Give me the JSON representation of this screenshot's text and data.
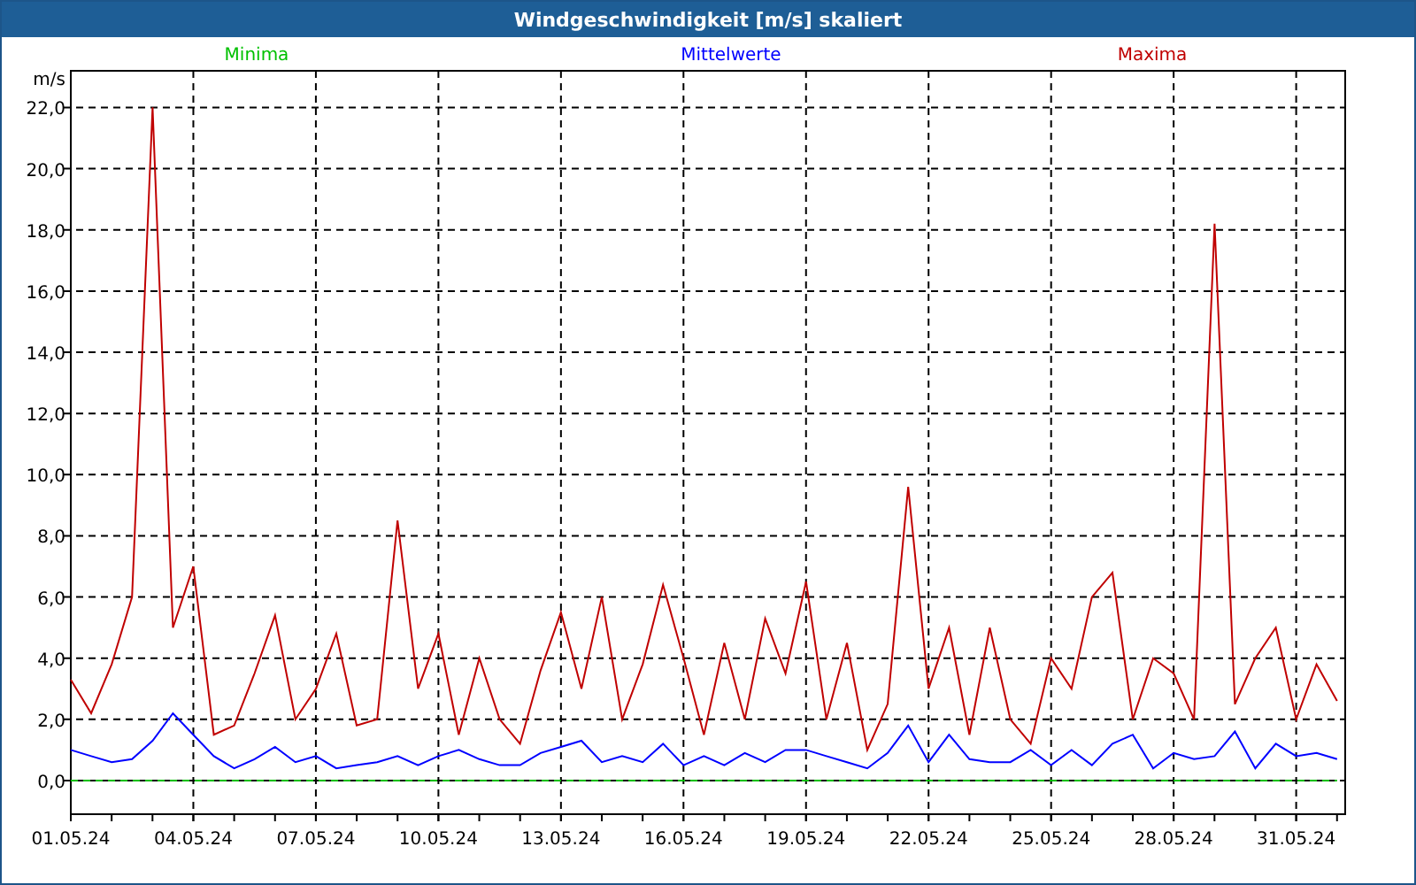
{
  "window": {
    "title": "Windgeschwindigkeit [m/s] skaliert"
  },
  "chart": {
    "chart_data": {
      "type": "line",
      "ylabel": "m/s",
      "categories": [
        "01.05.24",
        null,
        null,
        null,
        null,
        null,
        "04.05.24",
        null,
        null,
        null,
        null,
        null,
        "07.05.24",
        null,
        null,
        null,
        null,
        null,
        "10.05.24",
        null,
        null,
        null,
        null,
        null,
        "13.05.24",
        null,
        null,
        null,
        null,
        null,
        "16.05.24",
        null,
        null,
        null,
        null,
        null,
        "19.05.24",
        null,
        null,
        null,
        null,
        null,
        "22.05.24",
        null,
        null,
        null,
        null,
        null,
        "25.05.24",
        null,
        null,
        null,
        null,
        null,
        "28.05.24",
        null,
        null,
        null,
        null,
        null,
        "31.05.24",
        null,
        null
      ],
      "series": [
        {
          "name": "Minima",
          "color": "#00c000",
          "line_style": "dashed",
          "values": [
            0,
            0,
            0,
            0,
            0,
            0,
            0,
            0,
            0,
            0,
            0,
            0,
            0,
            0,
            0,
            0,
            0,
            0,
            0,
            0,
            0,
            0,
            0,
            0,
            0,
            0,
            0,
            0,
            0,
            0,
            0,
            0,
            0,
            0,
            0,
            0,
            0,
            0,
            0,
            0,
            0,
            0,
            0,
            0,
            0,
            0,
            0,
            0,
            0,
            0,
            0,
            0,
            0,
            0,
            0,
            0,
            0,
            0,
            0,
            0,
            0,
            0,
            0
          ]
        },
        {
          "name": "Mittelwerte",
          "color": "#0000ff",
          "line_style": "solid",
          "values": [
            1.0,
            0.8,
            0.6,
            0.7,
            1.3,
            2.2,
            1.5,
            0.8,
            0.4,
            0.7,
            1.1,
            0.6,
            0.8,
            0.4,
            0.5,
            0.6,
            0.8,
            0.5,
            0.8,
            1.0,
            0.7,
            0.5,
            0.5,
            0.9,
            1.1,
            1.3,
            0.6,
            0.8,
            0.6,
            1.2,
            0.5,
            0.8,
            0.5,
            0.9,
            0.6,
            1.0,
            1.0,
            0.8,
            0.6,
            0.4,
            0.9,
            1.8,
            0.6,
            1.5,
            0.7,
            0.6,
            0.6,
            1.0,
            0.5,
            1.0,
            0.5,
            1.2,
            1.5,
            0.4,
            0.9,
            0.7,
            0.8,
            1.6,
            0.4,
            1.2,
            0.8,
            0.9,
            0.7
          ]
        },
        {
          "name": "Maxima",
          "color": "#c00000",
          "line_style": "solid",
          "values": [
            3.3,
            2.2,
            3.8,
            6.0,
            22.0,
            5.0,
            7.0,
            1.5,
            1.8,
            3.5,
            5.4,
            2.0,
            3.0,
            4.8,
            1.8,
            2.0,
            8.5,
            3.0,
            4.8,
            1.5,
            4.0,
            2.0,
            1.2,
            3.6,
            5.5,
            3.0,
            6.0,
            2.0,
            3.8,
            6.4,
            4.0,
            1.5,
            4.5,
            2.0,
            5.3,
            3.5,
            6.5,
            2.0,
            4.5,
            1.0,
            2.5,
            9.6,
            3.0,
            5.0,
            1.5,
            5.0,
            2.0,
            1.2,
            4.0,
            3.0,
            6.0,
            6.8,
            2.0,
            4.0,
            3.5,
            2.0,
            18.2,
            2.5,
            4.0,
            5.0,
            2.0,
            3.8,
            2.6
          ]
        }
      ],
      "ylim": [
        -1.1,
        23.2
      ],
      "grid": true,
      "yticks": [
        {
          "value": 0,
          "label": "0,0"
        },
        {
          "value": 2,
          "label": "2,0"
        },
        {
          "value": 4,
          "label": "4,0"
        },
        {
          "value": 6,
          "label": "6,0"
        },
        {
          "value": 8,
          "label": "8,0"
        },
        {
          "value": 10,
          "label": "10,0"
        },
        {
          "value": 12,
          "label": "12,0"
        },
        {
          "value": 14,
          "label": "14,0"
        },
        {
          "value": 16,
          "label": "16,0"
        },
        {
          "value": 18,
          "label": "18,0"
        },
        {
          "value": 20,
          "label": "20,0"
        },
        {
          "value": 22,
          "label": "22,0"
        }
      ]
    }
  }
}
